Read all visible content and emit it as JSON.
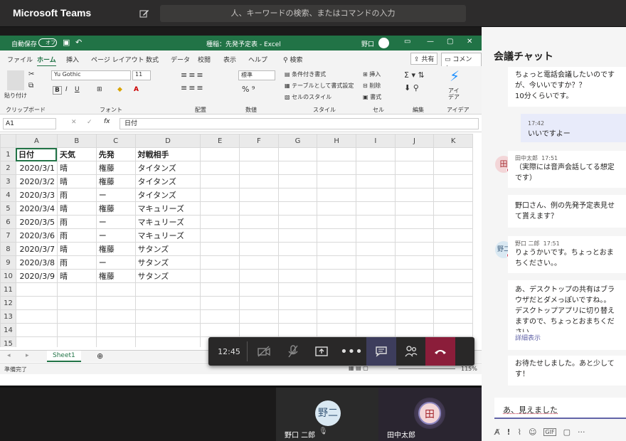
{
  "app": {
    "title": "Microsoft Teams",
    "search_placeholder": "人、キーワードの検索、またはコマンドの入力"
  },
  "excel": {
    "autosave_label": "自動保存",
    "autosave_state": "オフ",
    "window_title": "種稲：先発予定表 - Excel",
    "user": "野口",
    "menu_tabs": [
      "ファイル",
      "ホーム",
      "挿入",
      "ページ レイアウト",
      "数式",
      "データ",
      "校閲",
      "表示",
      "ヘルプ",
      "検索"
    ],
    "share_label": "共有",
    "comment_label": "コメント",
    "ribbon": {
      "paste": "貼り付け",
      "clipboard": "クリップボード",
      "font_name": "Yu Gothic",
      "font_size": "11",
      "font_group": "フォント",
      "alignment_group": "配置",
      "number_format": "標準",
      "number_group": "数値",
      "cond_format": "条件付き書式",
      "table_format": "テーブルとして書式設定",
      "cell_style": "セルのスタイル",
      "style_group": "スタイル",
      "insert": "挿入",
      "delete": "削除",
      "format": "書式",
      "cell_group": "セル",
      "edit_group": "編集",
      "ideas": "アイデア",
      "ideas_group": "アイデア"
    },
    "name_box": "A1",
    "formula_value": "日付",
    "columns": [
      "A",
      "B",
      "C",
      "D",
      "E",
      "F",
      "G",
      "H",
      "I",
      "J",
      "K"
    ],
    "rows": [
      [
        "日付",
        "天気",
        "先発",
        "対戦相手"
      ],
      [
        "2020/3/1",
        "晴",
        "権藤",
        "タイタンズ"
      ],
      [
        "2020/3/2",
        "晴",
        "権藤",
        "タイタンズ"
      ],
      [
        "2020/3/3",
        "雨",
        "ー",
        "タイタンズ"
      ],
      [
        "2020/3/4",
        "晴",
        "権藤",
        "マキュリーズ"
      ],
      [
        "2020/3/5",
        "雨",
        "ー",
        "マキュリーズ"
      ],
      [
        "2020/3/6",
        "雨",
        "ー",
        "マキュリーズ"
      ],
      [
        "2020/3/7",
        "晴",
        "権藤",
        "サタンズ"
      ],
      [
        "2020/3/8",
        "雨",
        "ー",
        "サタンズ"
      ],
      [
        "2020/3/9",
        "晴",
        "権藤",
        "サタンズ"
      ],
      [
        "",
        "",
        "",
        ""
      ],
      [
        "",
        "",
        "",
        ""
      ],
      [
        "",
        "",
        "",
        ""
      ],
      [
        "",
        "",
        "",
        ""
      ],
      [
        "",
        "",
        "",
        ""
      ]
    ],
    "row_numbers": [
      "1",
      "2",
      "3",
      "4",
      "5",
      "6",
      "7",
      "8",
      "9",
      "10",
      "11",
      "12",
      "13",
      "14",
      "15"
    ],
    "sheet_tab": "Sheet1",
    "status_left": "準備完了",
    "zoom": "115%"
  },
  "call": {
    "duration": "12:45"
  },
  "participants": [
    {
      "initials": "野二",
      "name": "野口 二郎"
    },
    {
      "initials": "田",
      "name": "田中太郎"
    }
  ],
  "chat": {
    "title": "会議チャット",
    "m0": [
      "ちょっと電話会議したいのです",
      "が、今いいですか？？",
      "10分くらいです。"
    ],
    "own_time": "17:42",
    "own_text": "いいですよー",
    "tanaka": {
      "initial": "田",
      "name": "田中太郎",
      "time": "17:51",
      "m1": [
        "（実際には音声会話してる想定",
        "です）"
      ],
      "m2": [
        "野口さん、例の先発予定表見せ",
        "て貰えます？"
      ]
    },
    "noguchi": {
      "initials": "野二",
      "name": "野口 二郎",
      "time": "17:51",
      "m1": [
        "りょうかいです。ちょっとおま",
        "ちください。。"
      ],
      "m2": [
        "あ、デスクトップの共有はブラ",
        "ウザだとダメっぽいですね。。",
        "デスクトップアプリに切り替え",
        "ますので、ちょっとおまちくだ",
        "さい"
      ],
      "more": "詳細表示",
      "m3": [
        "お待たせしました。あと少して",
        "す！"
      ]
    },
    "compose_text": "あ、見えました"
  },
  "colors": {
    "teams_dark": "#2d2c2c",
    "excel_green": "#217346",
    "hangup": "#c4314b",
    "accent": "#6264a7"
  }
}
